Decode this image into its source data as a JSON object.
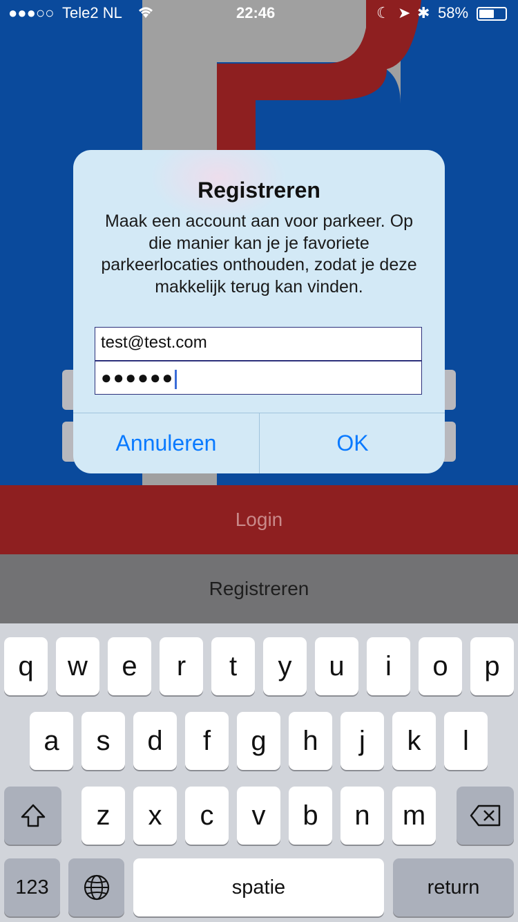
{
  "status_bar": {
    "carrier": "Tele2 NL",
    "time": "22:46",
    "battery_percent": "58%",
    "battery_level": 0.58
  },
  "background": {
    "login_label": "Login",
    "register_label": "Registreren"
  },
  "dialog": {
    "title": "Registreren",
    "message": "Maak een account aan voor parkeer. Op die manier kan je je favoriete parkeerlocaties onthouden, zodat je deze makkelijk terug kan vinden.",
    "email_value": "test@test.com",
    "password_masked": "●●●●●●",
    "cancel_label": "Annuleren",
    "ok_label": "OK"
  },
  "keyboard": {
    "row1": [
      "q",
      "w",
      "e",
      "r",
      "t",
      "y",
      "u",
      "i",
      "o",
      "p"
    ],
    "row2": [
      "a",
      "s",
      "d",
      "f",
      "g",
      "h",
      "j",
      "k",
      "l"
    ],
    "row3": [
      "z",
      "x",
      "c",
      "v",
      "b",
      "n",
      "m"
    ],
    "numbers_label": "123",
    "space_label": "spatie",
    "return_label": "return",
    "shift_icon": "shift-icon",
    "delete_icon": "delete-icon",
    "globe_icon": "globe-icon"
  },
  "colors": {
    "brand_blue": "#0a4a9c",
    "brand_red": "#8e1f20",
    "ios_blue": "#0a7aff"
  }
}
